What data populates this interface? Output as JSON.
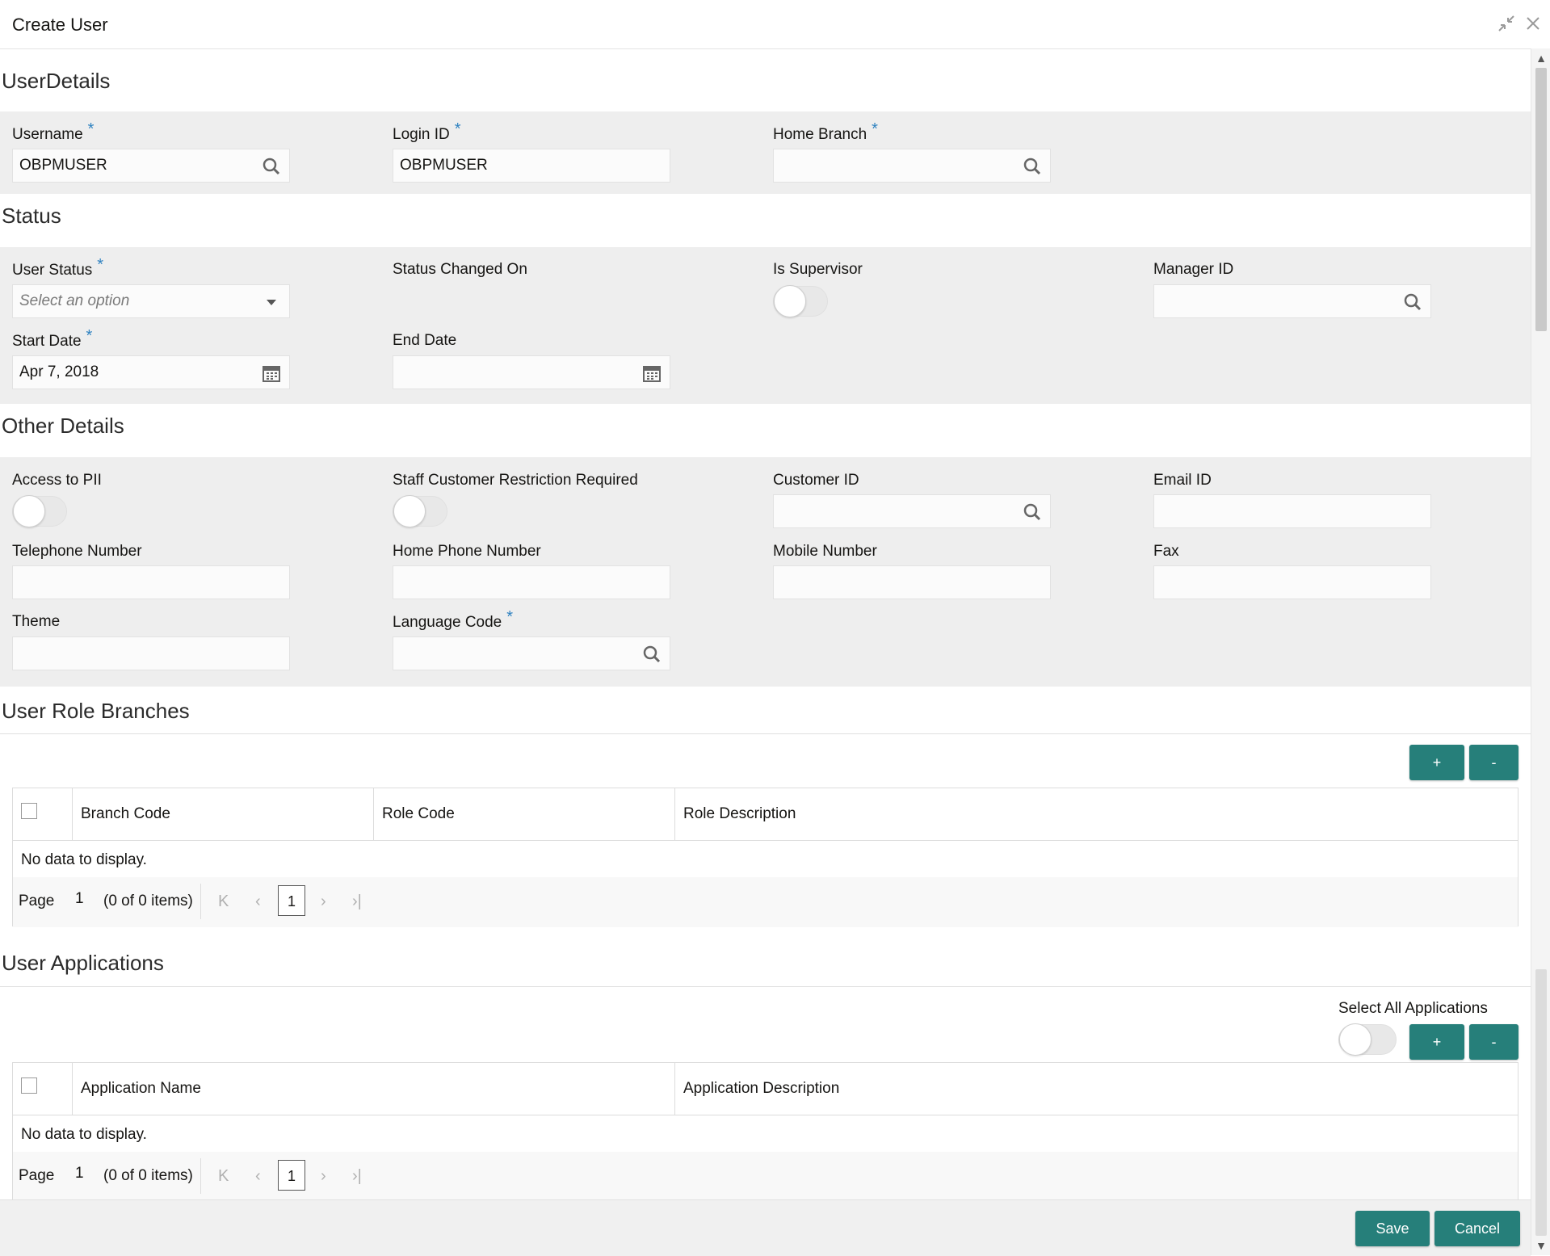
{
  "window": {
    "title": "Create User",
    "minimize_icon": "compress-icon",
    "close_icon": "close-icon"
  },
  "sections": {
    "user_details": "UserDetails",
    "status": "Status",
    "other_details": "Other Details",
    "user_role_branches": "User Role Branches",
    "user_applications": "User Applications"
  },
  "user_details": {
    "username": {
      "label": "Username",
      "value": "OBPMUSER"
    },
    "login_id": {
      "label": "Login ID",
      "value": "OBPMUSER"
    },
    "home_branch": {
      "label": "Home Branch",
      "value": ""
    }
  },
  "status": {
    "user_status": {
      "label": "User Status",
      "placeholder": "Select an option"
    },
    "status_changed_on": {
      "label": "Status Changed On"
    },
    "is_supervisor": {
      "label": "Is Supervisor",
      "on": false
    },
    "manager_id": {
      "label": "Manager ID",
      "value": ""
    },
    "start_date": {
      "label": "Start Date",
      "value": "Apr 7, 2018"
    },
    "end_date": {
      "label": "End Date",
      "value": ""
    }
  },
  "other_details": {
    "access_to_pii": {
      "label": "Access to PII",
      "on": false
    },
    "staff_restriction": {
      "label": "Staff Customer Restriction Required",
      "on": false
    },
    "customer_id": {
      "label": "Customer ID",
      "value": ""
    },
    "email_id": {
      "label": "Email ID",
      "value": ""
    },
    "telephone": {
      "label": "Telephone Number",
      "value": ""
    },
    "home_phone": {
      "label": "Home Phone Number",
      "value": ""
    },
    "mobile": {
      "label": "Mobile Number",
      "value": ""
    },
    "fax": {
      "label": "Fax",
      "value": ""
    },
    "theme": {
      "label": "Theme",
      "value": ""
    },
    "language_code": {
      "label": "Language Code",
      "value": ""
    }
  },
  "required_marker": "*",
  "role_branches": {
    "add_label": "+",
    "remove_label": "-",
    "columns": [
      "Branch Code",
      "Role Code",
      "Role Description"
    ],
    "no_data": "No data to display.",
    "pager": {
      "page_label": "Page",
      "page_number": "1",
      "items_text": "(0 of 0 items)",
      "current": "1"
    }
  },
  "applications": {
    "select_all_label": "Select All Applications",
    "select_all_on": false,
    "add_label": "+",
    "remove_label": "-",
    "columns": [
      "Application Name",
      "Application Description"
    ],
    "no_data": "No data to display.",
    "pager": {
      "page_label": "Page",
      "page_number": "1",
      "items_text": "(0 of 0 items)",
      "current": "1"
    }
  },
  "footer": {
    "save_label": "Save",
    "cancel_label": "Cancel"
  },
  "colors": {
    "accent": "#267f7a",
    "required": "#2f82c0",
    "panel": "#eeeeee"
  }
}
